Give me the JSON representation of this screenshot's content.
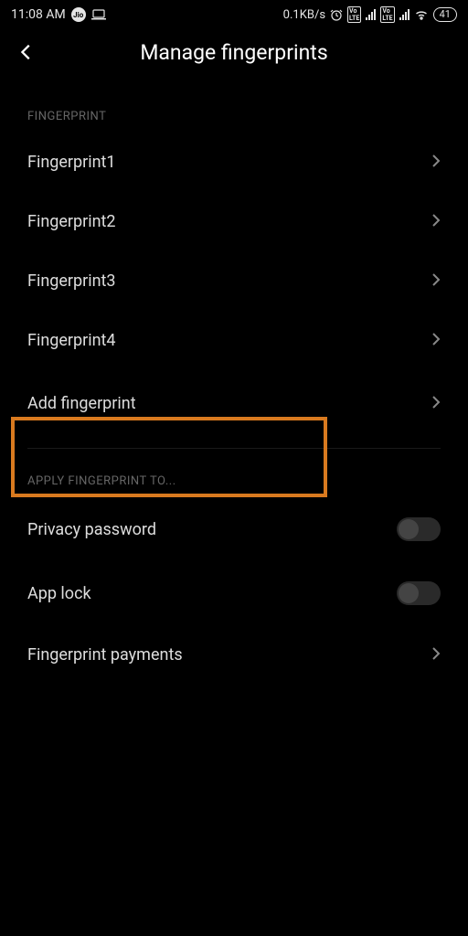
{
  "status": {
    "time": "11:08 AM",
    "data_rate": "0.1KB/s",
    "battery": "41"
  },
  "header": {
    "title": "Manage fingerprints"
  },
  "sections": {
    "fingerprint_header": "FINGERPRINT",
    "apply_header": "APPLY FINGERPRINT TO..."
  },
  "fingerprints": [
    {
      "label": "Fingerprint1"
    },
    {
      "label": "Fingerprint2"
    },
    {
      "label": "Fingerprint3"
    },
    {
      "label": "Fingerprint4"
    }
  ],
  "add_label": "Add fingerprint",
  "apply_items": {
    "privacy_password": "Privacy password",
    "app_lock": "App lock",
    "fingerprint_payments": "Fingerprint payments"
  },
  "toggles": {
    "privacy_password": false,
    "app_lock": false
  },
  "highlight_color": "#d97a1f"
}
